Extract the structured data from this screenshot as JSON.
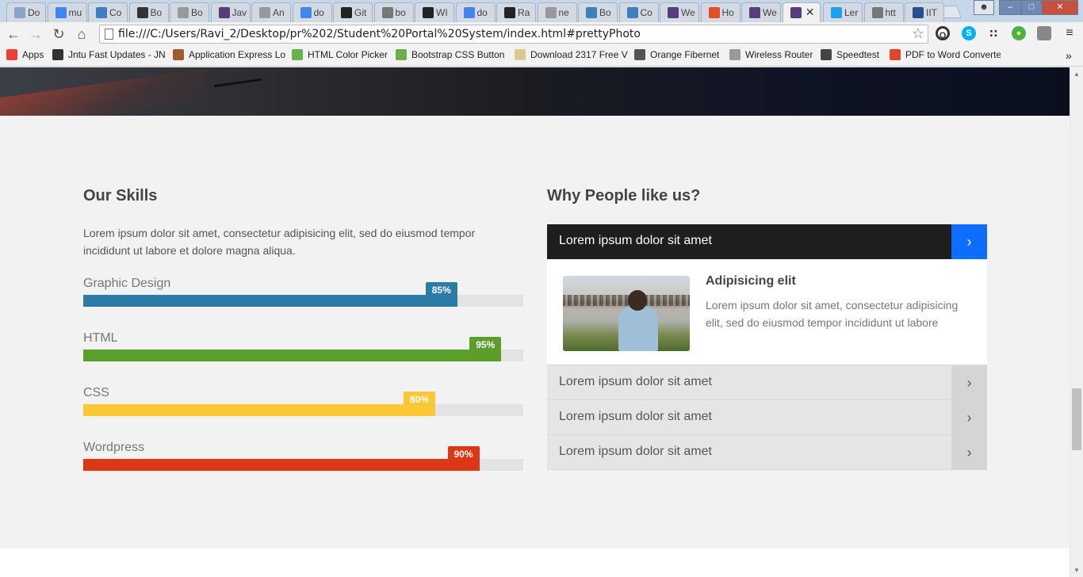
{
  "browser": {
    "tabs": [
      {
        "title": "Do",
        "icon_color": "#8aa4c8"
      },
      {
        "title": "mu",
        "icon_color": "#4285f4"
      },
      {
        "title": "Co",
        "icon_color": "#3f7fc1"
      },
      {
        "title": "Bo",
        "icon_color": "#333333"
      },
      {
        "title": "Bo",
        "icon_color": "#999999"
      },
      {
        "title": "Jav",
        "icon_color": "#563d7c"
      },
      {
        "title": "An",
        "icon_color": "#999999"
      },
      {
        "title": "do",
        "icon_color": "#4285f4"
      },
      {
        "title": "Git",
        "icon_color": "#222222"
      },
      {
        "title": "bo",
        "icon_color": "#777777"
      },
      {
        "title": "WI",
        "icon_color": "#222222"
      },
      {
        "title": "do",
        "icon_color": "#4285f4"
      },
      {
        "title": "Ra",
        "icon_color": "#222222"
      },
      {
        "title": "ne",
        "icon_color": "#999999"
      },
      {
        "title": "Bo",
        "icon_color": "#3f7fc1"
      },
      {
        "title": "Co",
        "icon_color": "#3f7fc1"
      },
      {
        "title": "We",
        "icon_color": "#563d7c"
      },
      {
        "title": "Ho",
        "icon_color": "#e34f26"
      },
      {
        "title": "We",
        "icon_color": "#563d7c"
      },
      {
        "title": "",
        "icon_color": "#563d7c",
        "active": true
      },
      {
        "title": "Ler",
        "icon_color": "#1da1f2"
      },
      {
        "title": "htt",
        "icon_color": "#777777"
      },
      {
        "title": "IIT",
        "icon_color": "#2a4f8f"
      }
    ],
    "url": "file:///C:/Users/Ravi_2/Desktop/pr%202/Student%20Portal%20System/index.html#prettyPhoto",
    "bookmarks": [
      {
        "label": "Apps",
        "icon_color": "#e94235"
      },
      {
        "label": "Jntu Fast Updates - JN",
        "icon_color": "#333333"
      },
      {
        "label": "Application Express Lo",
        "icon_color": "#a05a2c"
      },
      {
        "label": "HTML Color Picker",
        "icon_color": "#6ab04c"
      },
      {
        "label": "Bootstrap CSS Button",
        "icon_color": "#6ab04c"
      },
      {
        "label": "Download 2317 Free V",
        "icon_color": "#d9c88f"
      },
      {
        "label": "Orange Fibernet",
        "icon_color": "#555555"
      },
      {
        "label": "Wireless Router",
        "icon_color": "#999999"
      },
      {
        "label": "Speedtest",
        "icon_color": "#444444"
      },
      {
        "label": "PDF to Word Converte",
        "icon_color": "#e1452b"
      }
    ]
  },
  "skills_section": {
    "title": "Our Skills",
    "lead": "Lorem ipsum dolor sit amet, consectetur adipisicing elit, sed do eiusmod tempor incididunt ut labore et dolore magna aliqua.",
    "skills": [
      {
        "name": "Graphic Design",
        "percent_label": "85%",
        "percent": 85,
        "color": "#2c7ba6"
      },
      {
        "name": "HTML",
        "percent_label": "95%",
        "percent": 95,
        "color": "#5b9e2c"
      },
      {
        "name": "CSS",
        "percent_label": "80%",
        "percent": 80,
        "color": "#fbc735"
      },
      {
        "name": "Wordpress",
        "percent_label": "90%",
        "percent": 90,
        "color": "#dc3614"
      }
    ]
  },
  "why_section": {
    "title": "Why People like us?",
    "accordion": [
      {
        "label": "Lorem ipsum dolor sit amet",
        "open": true
      },
      {
        "label": "Lorem ipsum dolor sit amet",
        "open": false
      },
      {
        "label": "Lorem ipsum dolor sit amet",
        "open": false
      },
      {
        "label": "Lorem ipsum dolor sit amet",
        "open": false
      }
    ],
    "open_panel": {
      "title": "Adipisicing elit",
      "text": "Lorem ipsum dolor sit amet, consectetur adipisicing elit, sed do eiusmod tempor incididunt ut labore"
    },
    "accent_color": "#0d6efd"
  }
}
